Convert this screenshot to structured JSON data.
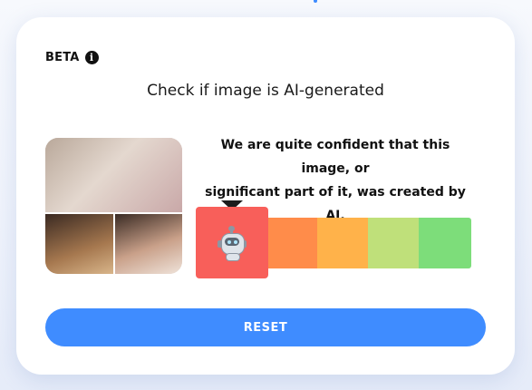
{
  "header": {
    "badge_label": "BETA",
    "info_icon": "info-icon",
    "title": "Check if image is AI-generated"
  },
  "result": {
    "verdict_line1": "We are quite confident that this image, or",
    "verdict_line2": "significant part of it, was created by AI.",
    "meter_icon": "robot-icon",
    "meter_level": 1,
    "meter_levels": 5,
    "colors": [
      "#f85f5a",
      "#ff8c4a",
      "#ffb24a",
      "#bfe07a",
      "#7ddd7a"
    ]
  },
  "actions": {
    "reset_label": "RESET"
  },
  "theme": {
    "accent": "#3f8cff"
  }
}
